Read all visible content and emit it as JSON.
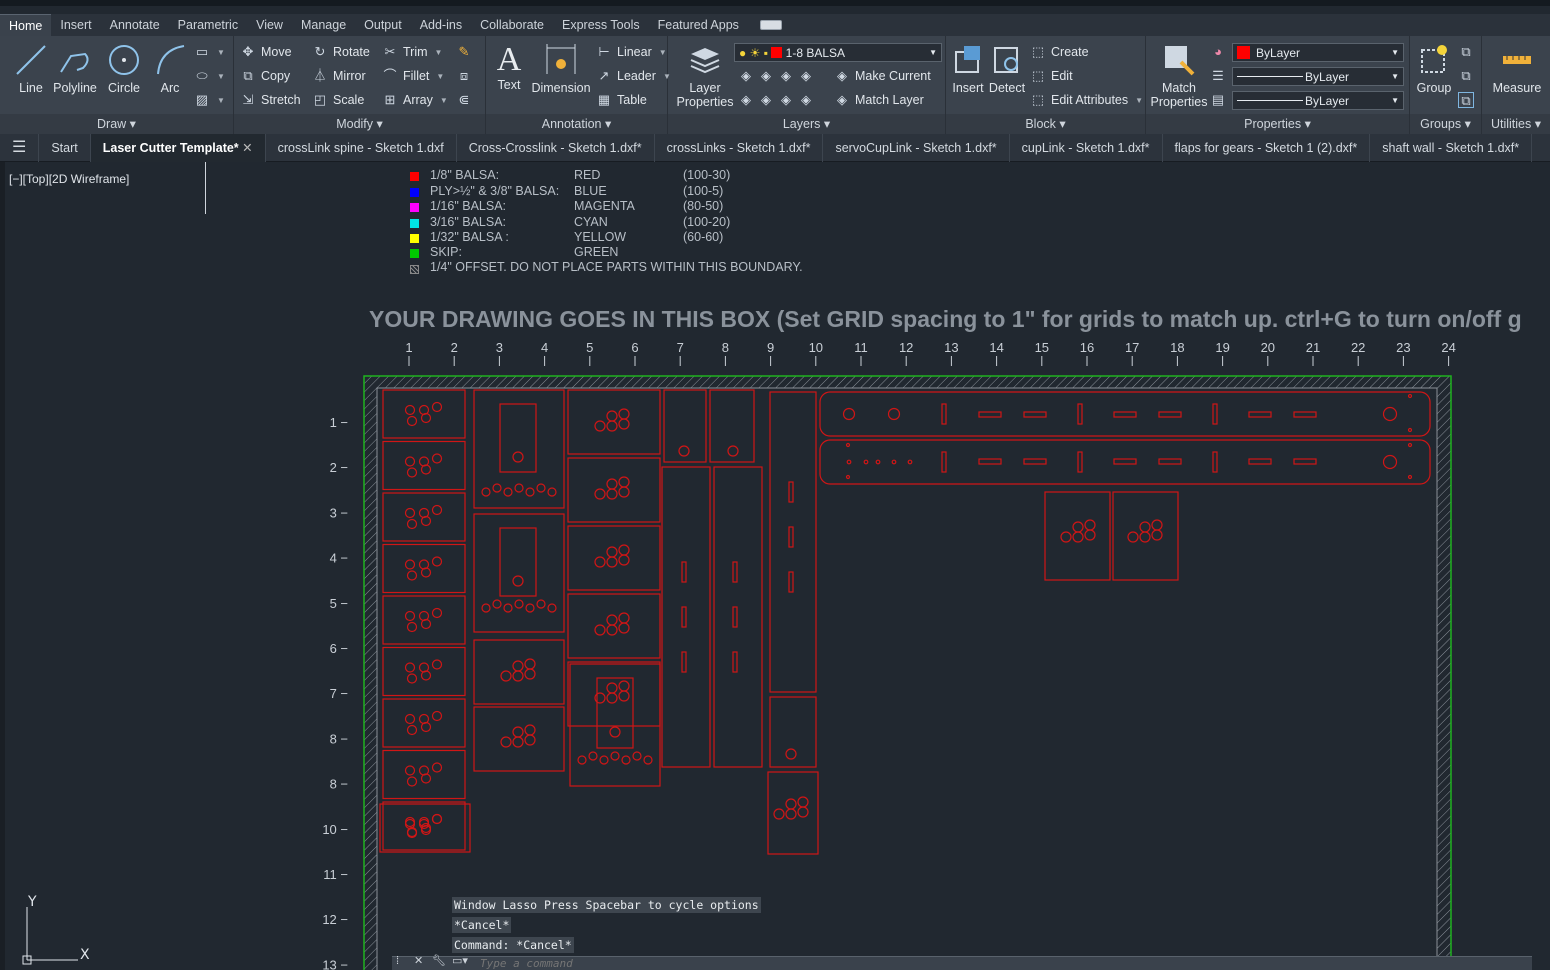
{
  "ribbon_tabs": [
    "Home",
    "Insert",
    "Annotate",
    "Parametric",
    "View",
    "Manage",
    "Output",
    "Add-ins",
    "Collaborate",
    "Express Tools",
    "Featured Apps"
  ],
  "draw": {
    "title": "Draw",
    "line": "Line",
    "polyline": "Polyline",
    "circle": "Circle",
    "arc": "Arc"
  },
  "modify": {
    "title": "Modify",
    "move": "Move",
    "rotate": "Rotate",
    "trim": "Trim",
    "copy": "Copy",
    "mirror": "Mirror",
    "fillet": "Fillet",
    "stretch": "Stretch",
    "scale": "Scale",
    "array": "Array"
  },
  "annotation": {
    "title": "Annotation",
    "text": "Text",
    "dimension": "Dimension",
    "linear": "Linear",
    "leader": "Leader",
    "table": "Table"
  },
  "layers": {
    "title": "Layers",
    "layer_properties": "Layer Properties",
    "current_layer": "1-8 BALSA",
    "make_current": "Make Current",
    "match_layer": "Match Layer",
    "current_layer_color": "#ff0000"
  },
  "block": {
    "title": "Block",
    "insert": "Insert",
    "detect": "Detect",
    "create": "Create",
    "edit": "Edit",
    "edit_attributes": "Edit Attributes"
  },
  "properties": {
    "title": "Properties",
    "match_properties": "Match Properties",
    "color": "ByLayer",
    "linetype": "ByLayer",
    "lineweight": "ByLayer"
  },
  "groups": {
    "title": "Groups",
    "group": "Group"
  },
  "utilities": {
    "title": "Utilities",
    "measure": "Measure"
  },
  "doc_tabs": {
    "start": "Start",
    "active": "Laser Cutter Template*",
    "others": [
      "crossLink spine - Sketch 1.dxf",
      "Cross-Crosslink - Sketch 1.dxf*",
      "crossLinks - Sketch 1.dxf*",
      "servoCupLink - Sketch 1.dxf*",
      "cupLink - Sketch 1.dxf*",
      "flaps for gears - Sketch 1 (2).dxf*",
      "shaft wall - Sketch 1.dxf*"
    ]
  },
  "viewport_label": "[−][Top][2D Wireframe]",
  "legend": [
    {
      "name": "1/8\" BALSA:",
      "color_name": "RED",
      "power": "(100-30)",
      "color": "#ff0000"
    },
    {
      "name": "PLY>½\" & 3/8\" BALSA:",
      "color_name": "BLUE",
      "power": "(100-5)",
      "color": "#0000ff"
    },
    {
      "name": "1/16\" BALSA:",
      "color_name": "MAGENTA",
      "power": "(80-50)",
      "color": "#ff00ff"
    },
    {
      "name": "3/16\" BALSA:",
      "color_name": "CYAN",
      "power": "(100-20)",
      "color": "#00e5e5"
    },
    {
      "name": "1/32\" BALSA :",
      "color_name": "YELLOW",
      "power": "(60-60)",
      "color": "#ffff00"
    },
    {
      "name": "SKIP:",
      "color_name": "GREEN",
      "power": "",
      "color": "#00c800"
    }
  ],
  "legend_offset": "1/4\" OFFSET. DO NOT PLACE PARTS WITHIN THIS BOUNDARY.",
  "banner": "YOUR DRAWING GOES IN THIS BOX (Set GRID spacing to 1\" for grids to match up. ctrl+G to turn on/off g",
  "x_ticks": [
    "1",
    "2",
    "3",
    "4",
    "5",
    "6",
    "7",
    "8",
    "9",
    "10",
    "11",
    "12",
    "13",
    "14",
    "15",
    "16",
    "17",
    "18",
    "19",
    "20",
    "21",
    "22",
    "23",
    "24"
  ],
  "y_ticks": [
    "1 −",
    "2 −",
    "3 −",
    "4 −",
    "5 −",
    "6 −",
    "7 −",
    "8 −",
    "8 −",
    "10 −",
    "11 −",
    "12 −",
    "13 −"
  ],
  "command_history": [
    "Window Lasso  Press Spacebar to cycle options",
    "*Cancel*",
    "Command: *Cancel*"
  ],
  "command_placeholder": "Type a command",
  "ucs": {
    "x": "X",
    "y": "Y"
  }
}
